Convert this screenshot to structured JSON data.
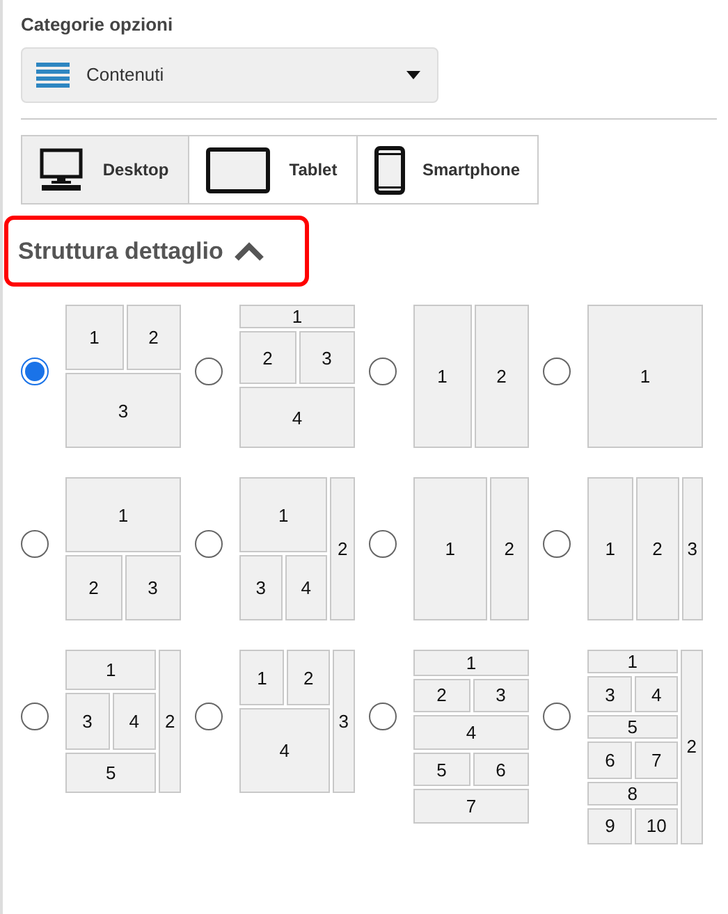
{
  "category": {
    "label": "Categorie opzioni",
    "value": "Contenuti"
  },
  "devices": [
    {
      "label": "Desktop",
      "kind": "desktop",
      "selected": true
    },
    {
      "label": "Tablet",
      "kind": "tablet",
      "selected": false
    },
    {
      "label": "Smartphone",
      "kind": "smartphone",
      "selected": false
    }
  ],
  "section": {
    "title": "Struttura dettaglio",
    "expanded": true,
    "highlighted": true
  },
  "layouts": [
    {
      "selected": true,
      "cells": [
        "1",
        "2",
        "3"
      ]
    },
    {
      "selected": false,
      "cells": [
        "1",
        "2",
        "3",
        "4"
      ]
    },
    {
      "selected": false,
      "cells": [
        "1",
        "2"
      ]
    },
    {
      "selected": false,
      "cells": [
        "1"
      ]
    },
    {
      "selected": false,
      "cells": [
        "1",
        "2",
        "3"
      ]
    },
    {
      "selected": false,
      "cells": [
        "1",
        "2",
        "3",
        "4"
      ]
    },
    {
      "selected": false,
      "cells": [
        "1",
        "2"
      ]
    },
    {
      "selected": false,
      "cells": [
        "1",
        "2",
        "3"
      ]
    },
    {
      "selected": false,
      "cells": [
        "1",
        "3",
        "4",
        "2",
        "5"
      ]
    },
    {
      "selected": false,
      "cells": [
        "1",
        "2",
        "3",
        "4"
      ]
    },
    {
      "selected": false,
      "cells": [
        "1",
        "2",
        "3",
        "4",
        "5",
        "6",
        "7"
      ]
    },
    {
      "selected": false,
      "cells": [
        "1",
        "2",
        "3",
        "4",
        "5",
        "6",
        "7",
        "8",
        "9",
        "10"
      ]
    }
  ]
}
